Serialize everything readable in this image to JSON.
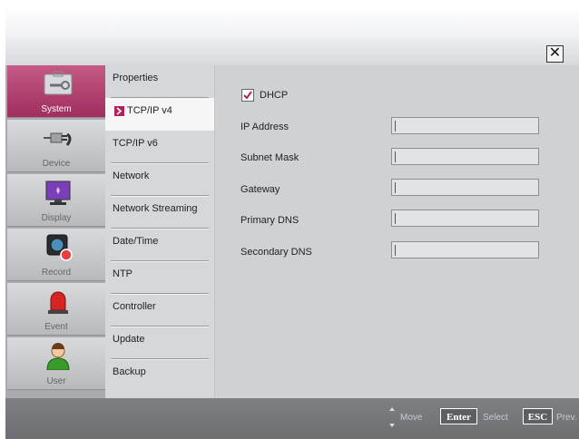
{
  "dialog": {
    "close_glyph": "✕"
  },
  "tabs": [
    {
      "label": "System",
      "icon": "wrench-icon",
      "active": true
    },
    {
      "label": "Device",
      "icon": "plug-icon",
      "active": false
    },
    {
      "label": "Display",
      "icon": "monitor-icon",
      "active": false
    },
    {
      "label": "Record",
      "icon": "camera-icon",
      "active": false
    },
    {
      "label": "Event",
      "icon": "siren-icon",
      "active": false
    },
    {
      "label": "User",
      "icon": "user-icon",
      "active": false
    }
  ],
  "menu": [
    {
      "label": "Properties",
      "active": false
    },
    {
      "label": "TCP/IP v4",
      "active": true
    },
    {
      "label": "TCP/IP v6",
      "active": false
    },
    {
      "label": "Network",
      "active": false
    },
    {
      "label": "Network Streaming",
      "active": false
    },
    {
      "label": "Date/Time",
      "active": false
    },
    {
      "label": "NTP",
      "active": false
    },
    {
      "label": "Controller",
      "active": false
    },
    {
      "label": "Update",
      "active": false
    },
    {
      "label": "Backup",
      "active": false
    }
  ],
  "form": {
    "dhcp_label": "DHCP",
    "dhcp_checked": true,
    "fields": [
      {
        "label": "IP Address",
        "value": ""
      },
      {
        "label": "Subnet Mask",
        "value": ""
      },
      {
        "label": "Gateway",
        "value": ""
      },
      {
        "label": "Primary DNS",
        "value": ""
      },
      {
        "label": "Secondary DNS",
        "value": ""
      }
    ]
  },
  "footer": {
    "move_label": "Move",
    "enter_key": "Enter",
    "select_label": "Select",
    "esc_key": "ESC",
    "prev_label": "Prev."
  },
  "colors": {
    "accent": "#a02e5e",
    "footer_bg": "#75777b"
  }
}
